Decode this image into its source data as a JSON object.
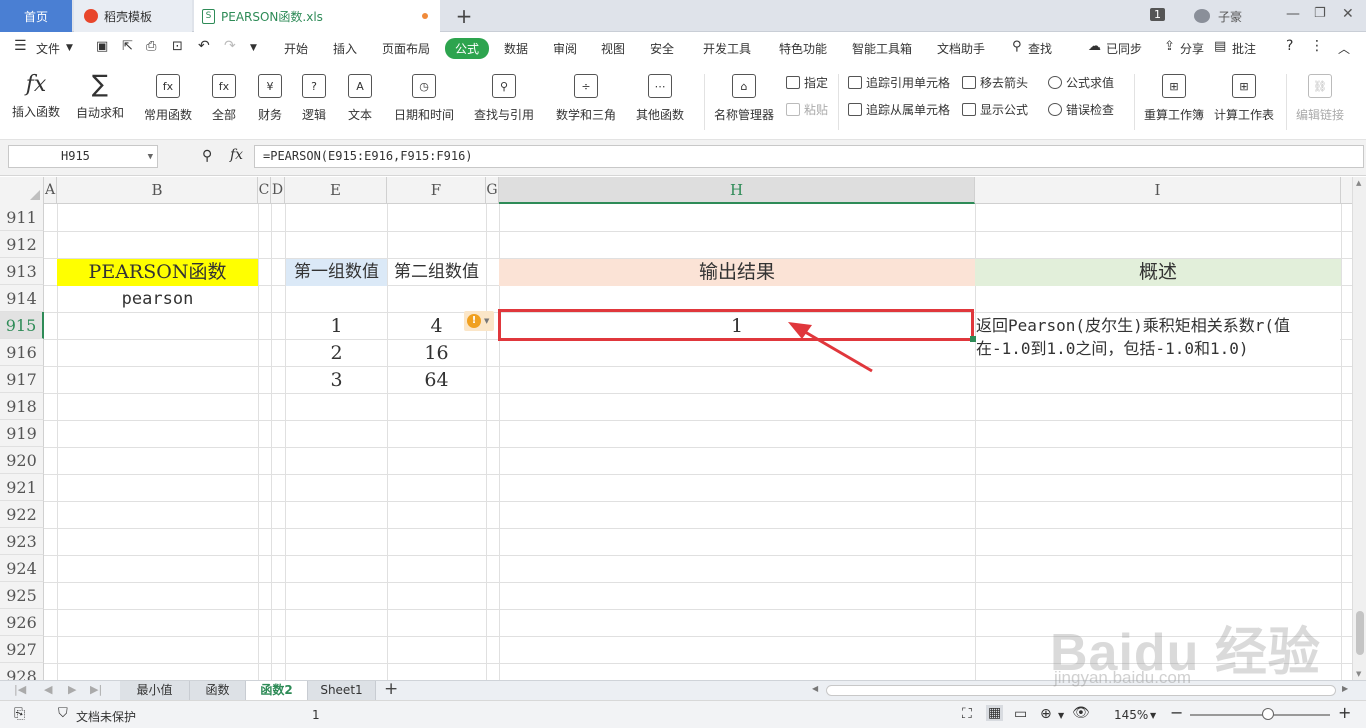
{
  "window_tabs": {
    "home": "首页",
    "template": "稻壳模板",
    "file": "PEARSON函数.xls",
    "add": "+",
    "badge": "1",
    "user": "子豪"
  },
  "menu": {
    "file": "文件",
    "items": [
      "开始",
      "插入",
      "页面布局",
      "公式",
      "数据",
      "审阅",
      "视图",
      "安全",
      "开发工具",
      "特色功能",
      "智能工具箱",
      "文档助手"
    ],
    "active": "公式",
    "search": "查找",
    "sync": "已同步",
    "share": "分享",
    "comment": "批注"
  },
  "ribbon": {
    "insert_func": "插入函数",
    "autosum": "自动求和",
    "common": "常用函数",
    "all": "全部",
    "finance": "财务",
    "logic": "逻辑",
    "text": "文本",
    "datetime": "日期和时间",
    "lookup": "查找与引用",
    "math": "数学和三角",
    "other": "其他函数",
    "name_mgr": "名称管理器",
    "assign": "指定",
    "paste": "粘贴",
    "trace_prec": "追踪引用单元格",
    "trace_dep": "追踪从属单元格",
    "remove_arrows": "移去箭头",
    "show_formula": "显示公式",
    "eval_formula": "公式求值",
    "error_check": "错误检查",
    "recalc_book": "重算工作簿",
    "recalc_sheet": "计算工作表",
    "edit_links": "编辑链接"
  },
  "formula_bar": {
    "name_box": "H915",
    "fx": "fx",
    "formula": "=PEARSON(E915:E916,F915:F916)"
  },
  "grid": {
    "columns": [
      "A",
      "B",
      "C",
      "D",
      "E",
      "F",
      "G",
      "H",
      "I"
    ],
    "rows": [
      "911",
      "912",
      "913",
      "914",
      "915",
      "916",
      "917",
      "918",
      "919",
      "920",
      "921",
      "922",
      "923",
      "924",
      "925",
      "926",
      "927",
      "928"
    ],
    "b913": "PEARSON函数",
    "b914": "pearson",
    "e913": "第一组数值",
    "f913": "第二组数值",
    "h913": "输出结果",
    "i913": "概述",
    "e915": "1",
    "e916": "2",
    "e917": "3",
    "f915": "4",
    "f916": "16",
    "f917": "64",
    "h915": "1",
    "i915": "返回Pearson(皮尔生)乘积矩相关系数r(值在-1.0到1.0之间，包括-1.0和1.0)",
    "colors": {
      "yellow": "#ffff00",
      "light_blue": "#dbe9f7",
      "peach": "#fbe3d6",
      "light_green": "#e2efda",
      "highlight_red": "#e0373c",
      "accent_green": "#2da44e"
    }
  },
  "sheets": {
    "tabs": [
      "最小值",
      "函数",
      "函数2",
      "Sheet1"
    ],
    "active": "函数2",
    "add": "+"
  },
  "status": {
    "protect": "文档未保护",
    "count": "1",
    "zoom": "145%"
  },
  "watermark": {
    "brand": "Baidu 经验",
    "url": "jingyan.baidu.com"
  }
}
